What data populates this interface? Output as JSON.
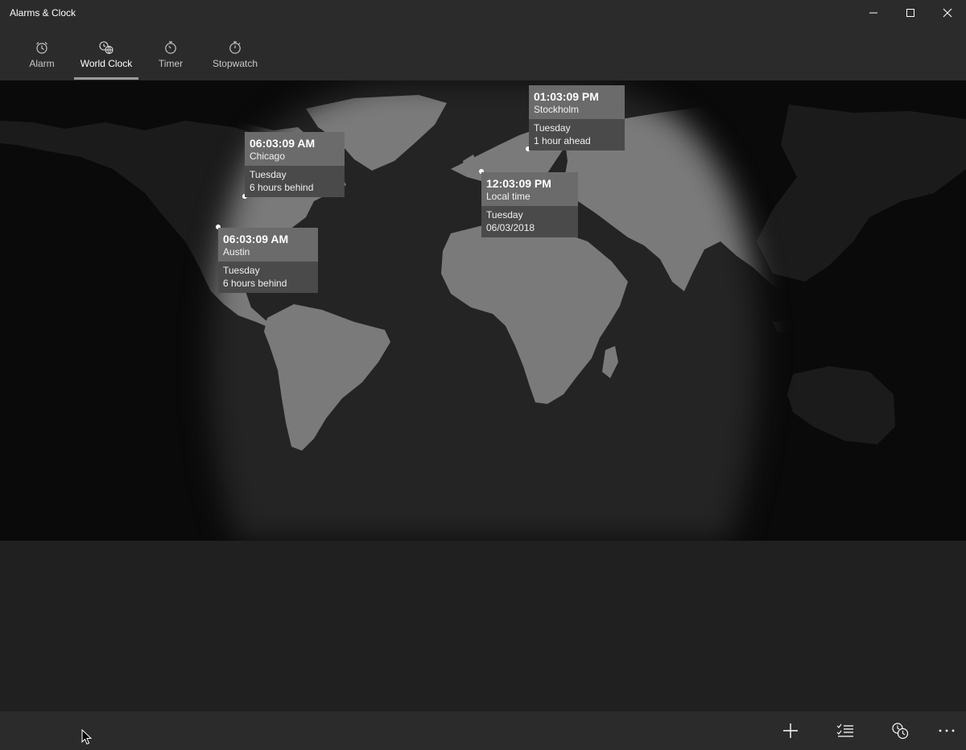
{
  "window": {
    "title": "Alarms & Clock",
    "controls": [
      "minimize-icon",
      "maximize-icon",
      "close-icon"
    ]
  },
  "tabs": [
    {
      "label": "Alarm",
      "icon": "alarm-clock-icon",
      "active": false
    },
    {
      "label": "World Clock",
      "icon": "globe-clock-icon",
      "active": true
    },
    {
      "label": "Timer",
      "icon": "timer-icon",
      "active": false
    },
    {
      "label": "Stopwatch",
      "icon": "stopwatch-icon",
      "active": false
    }
  ],
  "clocks": [
    {
      "time": "01:03:09 PM",
      "city": "Stockholm",
      "day": "Tuesday",
      "offset": "1 hour ahead"
    },
    {
      "time": "06:03:09 AM",
      "city": "Chicago",
      "day": "Tuesday",
      "offset": "6 hours behind"
    },
    {
      "time": "12:03:09 PM",
      "city": "Local time",
      "day": "Tuesday",
      "offset": "06/03/2018"
    },
    {
      "time": "06:03:09 AM",
      "city": "Austin",
      "day": "Tuesday",
      "offset": "6 hours behind"
    }
  ],
  "commandbar": {
    "buttons": [
      "add-icon",
      "select-list-icon",
      "compare-clock-icon",
      "more-icon"
    ]
  },
  "colors": {
    "chrome": "#2b2b2b",
    "background": "#202020",
    "land_day": "#7a7a7a",
    "ocean_day": "#242424",
    "night": "#0a0a0a"
  }
}
